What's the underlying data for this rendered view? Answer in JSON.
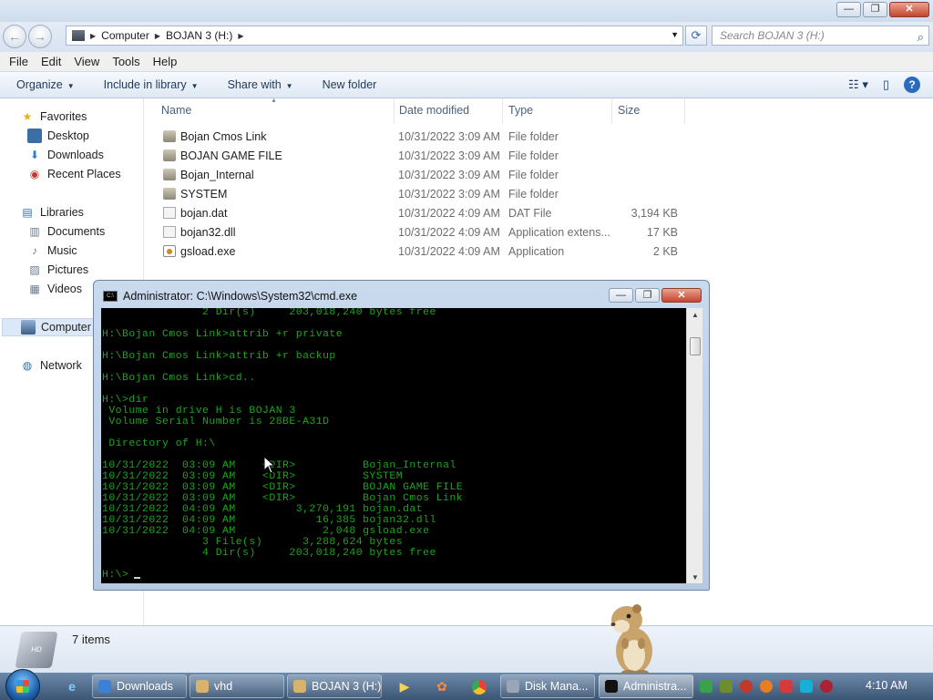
{
  "explorer": {
    "window_buttons": {
      "minimize": "—",
      "maximize": "❐",
      "close": "✕"
    },
    "address": {
      "crumbs": [
        "Computer",
        "BOJAN 3 (H:)"
      ]
    },
    "search": {
      "placeholder": "Search BOJAN 3 (H:)"
    },
    "menu": [
      "File",
      "Edit",
      "View",
      "Tools",
      "Help"
    ],
    "toolbar": {
      "organize": "Organize",
      "include_in_library": "Include in library",
      "share_with": "Share with",
      "new_folder": "New folder",
      "help": "?"
    },
    "nav": {
      "favorites": "Favorites",
      "desktop": "Desktop",
      "downloads": "Downloads",
      "recent_places": "Recent Places",
      "libraries": "Libraries",
      "documents": "Documents",
      "music": "Music",
      "pictures": "Pictures",
      "videos": "Videos",
      "computer": "Computer",
      "network": "Network"
    },
    "columns": {
      "name": "Name",
      "date": "Date modified",
      "type": "Type",
      "size": "Size"
    },
    "files": [
      {
        "name": "Bojan Cmos Link",
        "date": "10/31/2022 3:09 AM",
        "type": "File folder",
        "size": "",
        "icon": "folder"
      },
      {
        "name": "BOJAN GAME FILE",
        "date": "10/31/2022 3:09 AM",
        "type": "File folder",
        "size": "",
        "icon": "folder"
      },
      {
        "name": "Bojan_Internal",
        "date": "10/31/2022 3:09 AM",
        "type": "File folder",
        "size": "",
        "icon": "folder"
      },
      {
        "name": "SYSTEM",
        "date": "10/31/2022 3:09 AM",
        "type": "File folder",
        "size": "",
        "icon": "folder"
      },
      {
        "name": "bojan.dat",
        "date": "10/31/2022 4:09 AM",
        "type": "DAT File",
        "size": "3,194 KB",
        "icon": "file"
      },
      {
        "name": "bojan32.dll",
        "date": "10/31/2022 4:09 AM",
        "type": "Application extens...",
        "size": "17 KB",
        "icon": "file"
      },
      {
        "name": "gsload.exe",
        "date": "10/31/2022 4:09 AM",
        "type": "Application",
        "size": "2 KB",
        "icon": "exe"
      }
    ],
    "status": {
      "item_count": "7 items"
    }
  },
  "cmd": {
    "title": "Administrator: C:\\Windows\\System32\\cmd.exe",
    "lines": [
      "               2 Dir(s)     203,018,240 bytes free",
      "",
      "H:\\Bojan Cmos Link>attrib +r private",
      "",
      "H:\\Bojan Cmos Link>attrib +r backup",
      "",
      "H:\\Bojan Cmos Link>cd..",
      "",
      "H:\\>dir",
      " Volume in drive H is BOJAN 3",
      " Volume Serial Number is 28BE-A31D",
      "",
      " Directory of H:\\",
      "",
      "10/31/2022  03:09 AM    <DIR>          Bojan_Internal",
      "10/31/2022  03:09 AM    <DIR>          SYSTEM",
      "10/31/2022  03:09 AM    <DIR>          BOJAN GAME FILE",
      "10/31/2022  03:09 AM    <DIR>          Bojan Cmos Link",
      "10/31/2022  04:09 AM         3,270,191 bojan.dat",
      "10/31/2022  04:09 AM            16,385 bojan32.dll",
      "10/31/2022  04:09 AM             2,048 gsload.exe",
      "               3 File(s)      3,288,624 bytes",
      "               4 Dir(s)     203,018,240 bytes free",
      "",
      "H:\\>"
    ]
  },
  "taskbar": {
    "tasks": [
      {
        "label": "Downloads",
        "icon_color": "#3b82d6"
      },
      {
        "label": "vhd",
        "icon_color": "#d9b36a"
      },
      {
        "label": "BOJAN 3 (H:)",
        "icon_color": "#d9b36a"
      },
      {
        "label": "Disk Mana...",
        "icon_color": "#9aa6b5"
      },
      {
        "label": "Administra...",
        "icon_color": "#111111"
      }
    ],
    "clock": "4:10 AM"
  }
}
